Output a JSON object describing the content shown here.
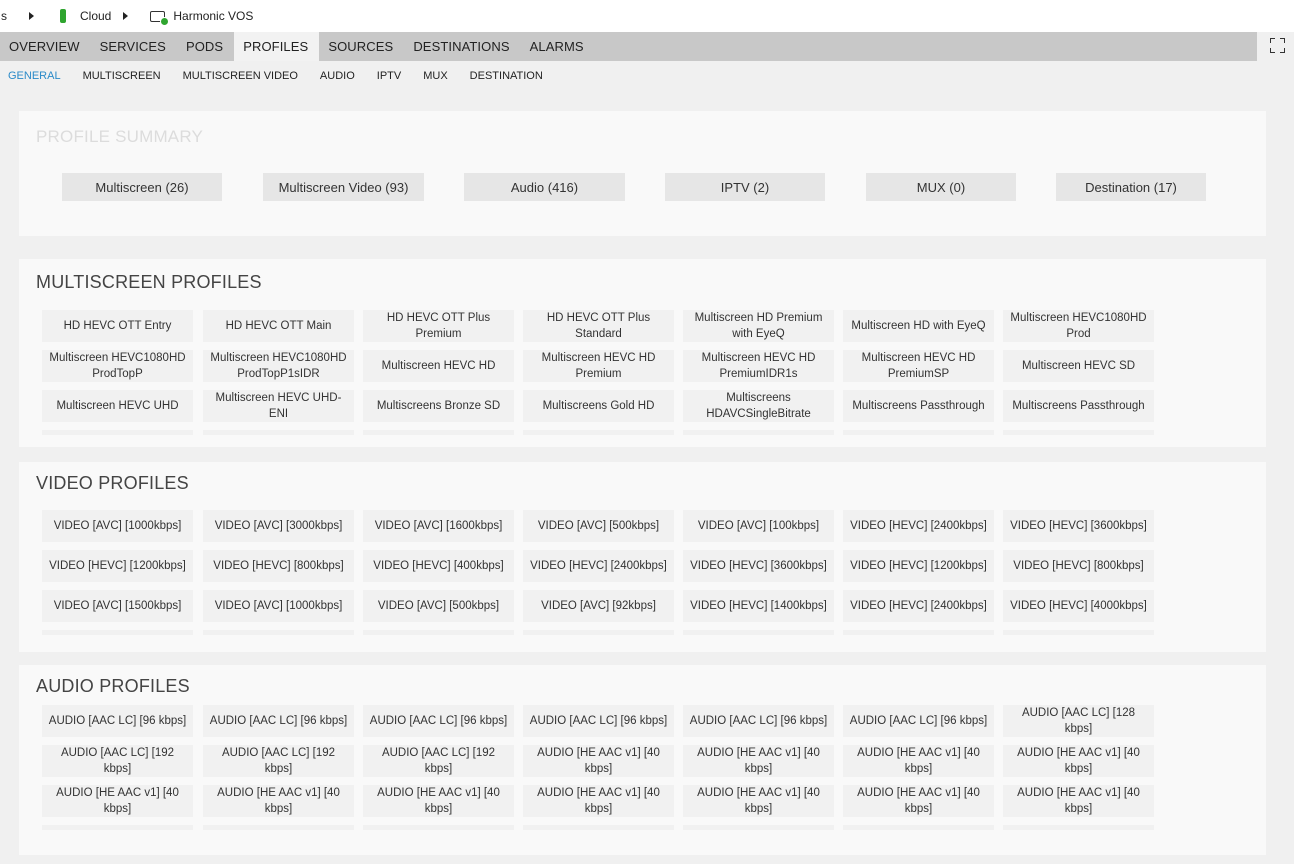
{
  "breadcrumb": {
    "first": "s",
    "cloud": "Cloud",
    "system": "Harmonic VOS"
  },
  "main_tabs": [
    "OVERVIEW",
    "SERVICES",
    "PODS",
    "PROFILES",
    "SOURCES",
    "DESTINATIONS",
    "ALARMS"
  ],
  "main_tab_active": "PROFILES",
  "sub_tabs": [
    "GENERAL",
    "MULTISCREEN",
    "MULTISCREEN VIDEO",
    "AUDIO",
    "IPTV",
    "MUX",
    "DESTINATION"
  ],
  "sub_tab_active": "GENERAL",
  "accent_color": "#2a8ac8",
  "summary": {
    "title": "PROFILE SUMMARY",
    "buttons": [
      "Multiscreen (26)",
      "Multiscreen Video (93)",
      "Audio (416)",
      "IPTV (2)",
      "MUX (0)",
      "Destination (17)"
    ]
  },
  "multiscreen": {
    "title": "MULTISCREEN PROFILES",
    "items": [
      "HD HEVC OTT Entry",
      "HD HEVC OTT Main",
      "HD HEVC OTT Plus Premium",
      "HD HEVC OTT Plus Standard",
      "Multiscreen HD Premium with EyeQ",
      "Multiscreen HD with EyeQ",
      "Multiscreen HEVC1080HD Prod",
      "Multiscreen HEVC1080HD ProdTopP",
      "Multiscreen HEVC1080HD ProdTopP1sIDR",
      "Multiscreen HEVC HD",
      "Multiscreen HEVC HD Premium",
      "Multiscreen HEVC HD PremiumIDR1s",
      "Multiscreen HEVC HD PremiumSP",
      "Multiscreen HEVC SD",
      "Multiscreen HEVC UHD",
      "Multiscreen HEVC UHD-ENI",
      "Multiscreens Bronze SD",
      "Multiscreens Gold HD",
      "Multiscreens HDAVCSingleBitrate",
      "Multiscreens Passthrough",
      "Multiscreens Passthrough"
    ]
  },
  "video": {
    "title": "VIDEO PROFILES",
    "items": [
      "VIDEO [AVC] [1000kbps]",
      "VIDEO [AVC] [3000kbps]",
      "VIDEO [AVC] [1600kbps]",
      "VIDEO [AVC] [500kbps]",
      "VIDEO [AVC] [100kbps]",
      "VIDEO [HEVC] [2400kbps]",
      "VIDEO [HEVC] [3600kbps]",
      "VIDEO [HEVC] [1200kbps]",
      "VIDEO [HEVC] [800kbps]",
      "VIDEO [HEVC] [400kbps]",
      "VIDEO [HEVC] [2400kbps]",
      "VIDEO [HEVC] [3600kbps]",
      "VIDEO [HEVC] [1200kbps]",
      "VIDEO [HEVC] [800kbps]",
      "VIDEO [AVC] [1500kbps]",
      "VIDEO [AVC] [1000kbps]",
      "VIDEO [AVC] [500kbps]",
      "VIDEO [AVC] [92kbps]",
      "VIDEO [HEVC] [1400kbps]",
      "VIDEO [HEVC] [2400kbps]",
      "VIDEO [HEVC] [4000kbps]"
    ]
  },
  "audio": {
    "title": "AUDIO PROFILES",
    "items": [
      "AUDIO [AAC LC] [96 kbps]",
      "AUDIO [AAC LC] [96 kbps]",
      "AUDIO [AAC LC] [96 kbps]",
      "AUDIO [AAC LC] [96 kbps]",
      "AUDIO [AAC LC] [96 kbps]",
      "AUDIO [AAC LC] [96 kbps]",
      "AUDIO [AAC LC] [128 kbps]",
      "AUDIO [AAC LC] [192 kbps]",
      "AUDIO [AAC LC] [192 kbps]",
      "AUDIO [AAC LC] [192 kbps]",
      "AUDIO [HE AAC v1] [40 kbps]",
      "AUDIO [HE AAC v1] [40 kbps]",
      "AUDIO [HE AAC v1] [40 kbps]",
      "AUDIO [HE AAC v1] [40 kbps]",
      "AUDIO [HE AAC v1] [40 kbps]",
      "AUDIO [HE AAC v1] [40 kbps]",
      "AUDIO [HE AAC v1] [40 kbps]",
      "AUDIO [HE AAC v1] [40 kbps]",
      "AUDIO [HE AAC v1] [40 kbps]",
      "AUDIO [HE AAC v1] [40 kbps]",
      "AUDIO [HE AAC v1] [40 kbps]"
    ]
  }
}
